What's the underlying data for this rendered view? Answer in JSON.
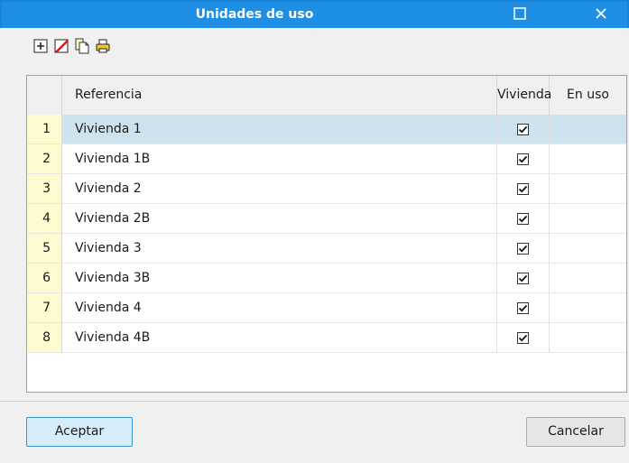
{
  "window": {
    "title": "Unidades de uso",
    "maximize_icon": "maximize-icon",
    "close_icon": "close-icon",
    "title_color": "#1e8fe4"
  },
  "toolbar": {
    "tools": [
      {
        "name": "add-row-icon"
      },
      {
        "name": "delete-row-icon"
      },
      {
        "name": "copy-icon"
      },
      {
        "name": "print-icon"
      }
    ]
  },
  "grid": {
    "headers": {
      "reference": "Referencia",
      "vivienda": "Vivienda",
      "en_uso": "En uso"
    },
    "rows": [
      {
        "num": "1",
        "reference": "Vivienda 1",
        "vivienda": true,
        "en_uso": ""
      },
      {
        "num": "2",
        "reference": "Vivienda 1B",
        "vivienda": true,
        "en_uso": ""
      },
      {
        "num": "3",
        "reference": "Vivienda 2",
        "vivienda": true,
        "en_uso": ""
      },
      {
        "num": "4",
        "reference": "Vivienda 2B",
        "vivienda": true,
        "en_uso": ""
      },
      {
        "num": "5",
        "reference": "Vivienda 3",
        "vivienda": true,
        "en_uso": ""
      },
      {
        "num": "6",
        "reference": "Vivienda 3B",
        "vivienda": true,
        "en_uso": ""
      },
      {
        "num": "7",
        "reference": "Vivienda 4",
        "vivienda": true,
        "en_uso": ""
      },
      {
        "num": "8",
        "reference": "Vivienda 4B",
        "vivienda": true,
        "en_uso": ""
      }
    ],
    "selected_row": 0,
    "row_number_color": "#fffbd0",
    "selection_color": "#cfe3ef"
  },
  "buttons": {
    "accept": "Aceptar",
    "cancel": "Cancelar"
  }
}
